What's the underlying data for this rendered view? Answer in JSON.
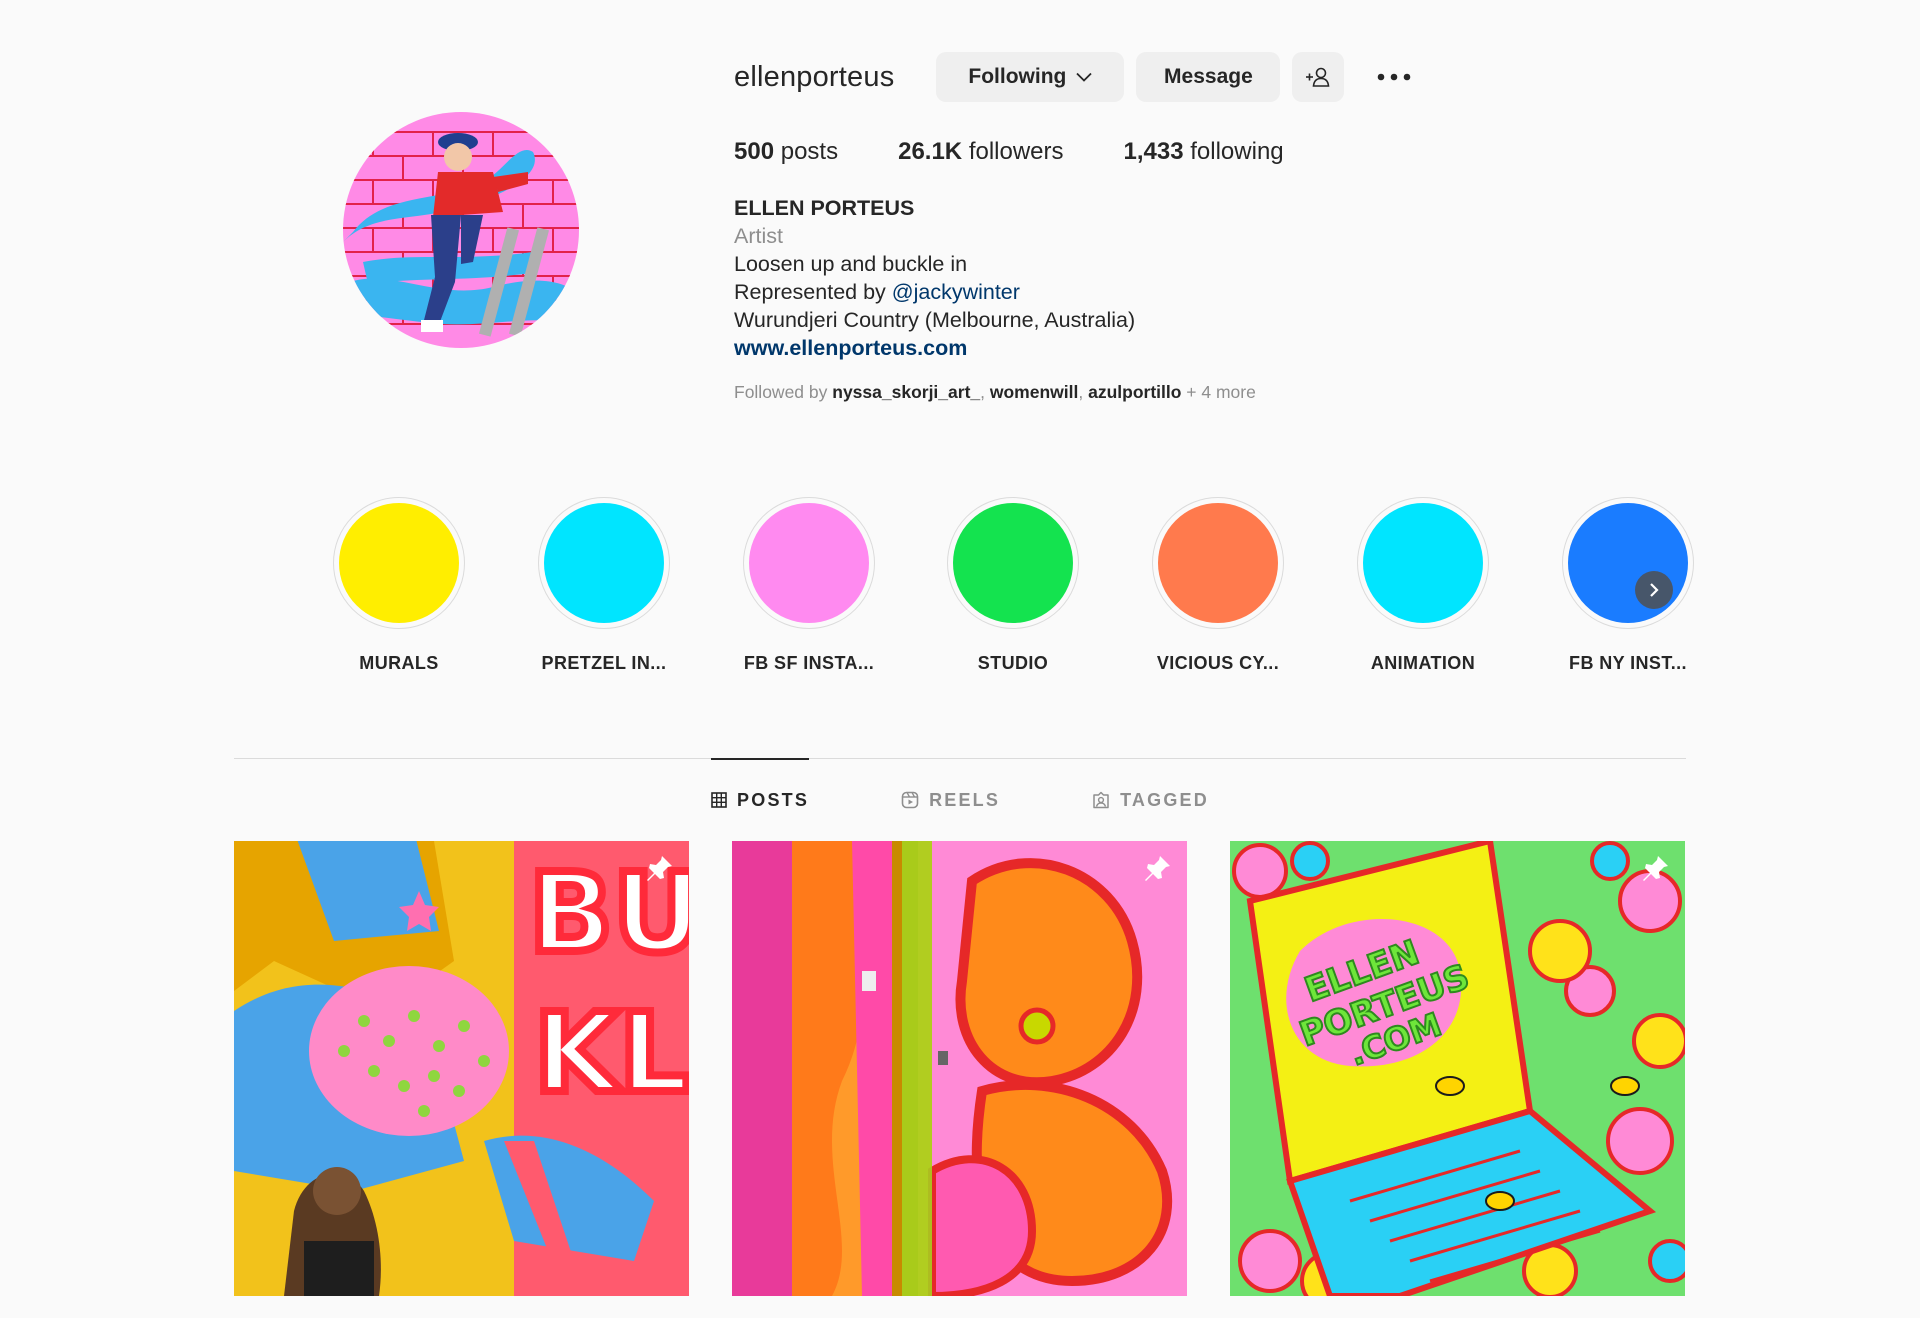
{
  "profile": {
    "username": "ellenporteus",
    "following_label": "Following",
    "message_label": "Message",
    "stats": {
      "posts_count": "500",
      "posts_label": "posts",
      "followers_count": "26.1K",
      "followers_label": "followers",
      "following_count": "1,433",
      "following_label": "following"
    },
    "bio": {
      "full_name": "ELLEN PORTEUS",
      "category": "Artist",
      "line1": "Loosen up and buckle in",
      "represented_prefix": "Represented by ",
      "represented_handle": "@jackywinter",
      "location": "Wurundjeri Country (Melbourne, Australia)",
      "website": "www.ellenporteus.com"
    },
    "followed_by": {
      "prefix": "Followed by ",
      "accounts": [
        "nyssa_skorji_art_",
        "womenwill",
        "azulportillo"
      ],
      "separator": ", ",
      "more": " + 4 more"
    }
  },
  "highlights": [
    {
      "label": "MURALS",
      "color": "#ffee00"
    },
    {
      "label": "PRETZEL IN...",
      "color": "#00e5ff"
    },
    {
      "label": "FB SF INSTA...",
      "color": "#ff8af0"
    },
    {
      "label": "STUDIO",
      "color": "#14e34f"
    },
    {
      "label": "VICIOUS CY...",
      "color": "#ff7a4d"
    },
    {
      "label": "ANIMATION",
      "color": "#00e5ff"
    },
    {
      "label": "FB NY INST...",
      "color": "#1a7cff"
    }
  ],
  "tabs": [
    {
      "label": "POSTS",
      "icon": "grid-icon",
      "active": true
    },
    {
      "label": "REELS",
      "icon": "reels-icon",
      "active": false
    },
    {
      "label": "TAGGED",
      "icon": "tagged-icon",
      "active": false
    }
  ],
  "posts": [
    {
      "pinned": true,
      "art_text": "BUCKLE"
    },
    {
      "pinned": true
    },
    {
      "pinned": true,
      "art_text": "ELLEN PORTEUS .COM"
    }
  ],
  "colors": {
    "link": "#00376b",
    "secondary_text": "#8e8e8e",
    "button_bg": "#efefef"
  }
}
